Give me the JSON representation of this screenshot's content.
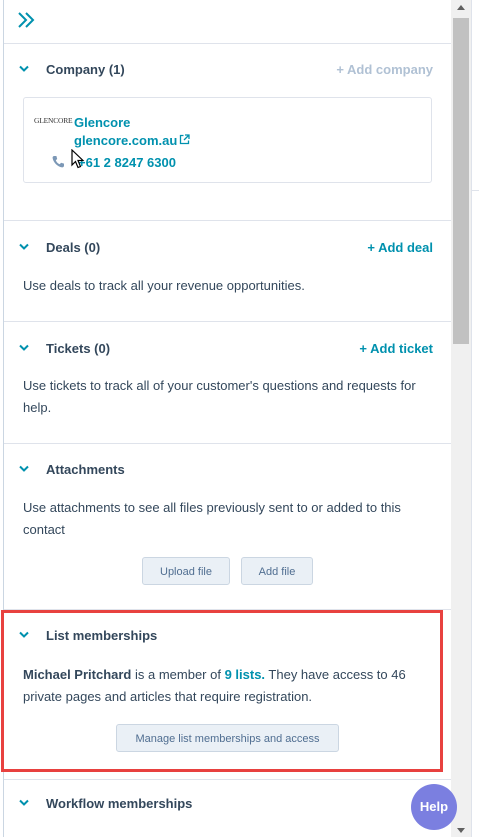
{
  "colors": {
    "link": "#0091ae",
    "text": "#33475b",
    "highlight": "#e8413f",
    "help": "#7b7fe0"
  },
  "company": {
    "title": "Company (1)",
    "add_label": "+ Add company",
    "card": {
      "logo_text": "GLENCORE",
      "name": "Glencore",
      "domain": "glencore.com.au",
      "phone": "+61 2 8247 6300"
    }
  },
  "deals": {
    "title": "Deals (0)",
    "add_label": "+ Add deal",
    "body": "Use deals to track all your revenue opportunities."
  },
  "tickets": {
    "title": "Tickets (0)",
    "add_label": "+ Add ticket",
    "body": "Use tickets to track all of your customer's questions and requests for help."
  },
  "attachments": {
    "title": "Attachments",
    "body": "Use attachments to see all files previously sent to or added to this contact",
    "upload_label": "Upload file",
    "add_label": "Add file"
  },
  "list_memberships": {
    "title": "List memberships",
    "contact_name": "Michael Pritchard",
    "text_1": " is a member of ",
    "lists_link": "9 lists.",
    "text_2": " They have access to 46 private pages and articles that require registration.",
    "manage_label": "Manage list memberships and access"
  },
  "workflow": {
    "title": "Workflow memberships"
  },
  "help": {
    "label": "Help"
  }
}
